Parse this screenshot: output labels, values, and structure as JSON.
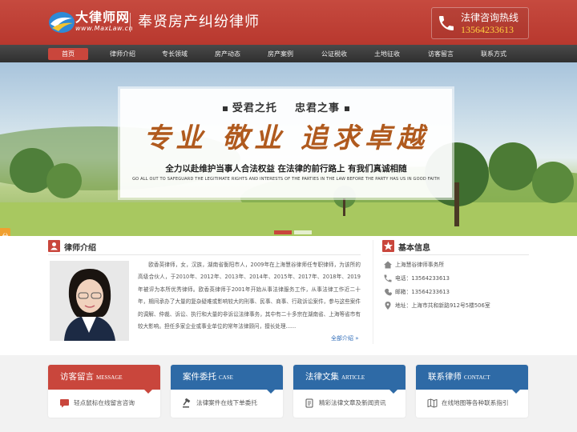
{
  "header": {
    "brand_cn": "大律师网",
    "brand_en": "www.MaxLaw.cn",
    "site_title": "奉贤房产纠纷律师",
    "hotline_label": "法律咨询热线",
    "hotline_number": "13564233613"
  },
  "nav": {
    "items": [
      {
        "label": "首页",
        "active": true
      },
      {
        "label": "律师介绍"
      },
      {
        "label": "专长领域"
      },
      {
        "label": "房产动态"
      },
      {
        "label": "房产案例"
      },
      {
        "label": "公证税收"
      },
      {
        "label": "土地征收"
      },
      {
        "label": "访客留言"
      },
      {
        "label": "联系方式"
      }
    ]
  },
  "banner": {
    "top_left": "受君之托",
    "top_right": "忠君之事",
    "slogan": "专业 敬业 追求卓越",
    "desc": "全力以赴维护当事人合法权益  在法律的前行路上  有我们真诚相随",
    "en": "GO ALL OUT TO SAFEGUARD THE LEGITIMATE RIGHTS AND INTERESTS OF THE PARTIES IN THE LAW BEFORE THE PARTY HAS US IN GOOD FAITH",
    "share": "分享"
  },
  "intro": {
    "title": "律师介绍",
    "text": "欧香英律师，女，汉族，湖南省衡阳市人，2009年在上海慧谷律师任专职律师，为该所的高级合伙人，于2010年、2012年、2013年、2014年、2015年、2017年、2018年、2019年被评为本所优秀律师。欧香英律师于2001年开始从事法律服务工作，从事法律工作近二十年，期间承办了大量的复杂疑难或影响较大的刑事、民事、商事、行政诉讼案件，参与这些案件的调解、仲裁、诉讼、执行和大量的非诉讼法律事务，其中有二十多宗在湖南省、上海等省市有较大影响。担任多家企业或事业单位的常年法律顾问，擅长处理......",
    "more": "全部介绍 »"
  },
  "info": {
    "title": "基本信息",
    "firm": "上海慧谷律师事务所",
    "phone": "电话：13564233613",
    "mobile": "邮箱：13564233613",
    "address": "地址：上海市共和新路912号5楼506室"
  },
  "cards": [
    {
      "title": "访客留言",
      "en": "MESSAGE",
      "desc": "轻点鼠标在线留言咨询",
      "color": "#c9463c"
    },
    {
      "title": "案件委托",
      "en": "CASE",
      "desc": "法律案件在线下单委托",
      "color": "#2e6aa6"
    },
    {
      "title": "法律文集",
      "en": "ARTICLE",
      "desc": "精彩法律文章及新闻资讯",
      "color": "#2e6aa6"
    },
    {
      "title": "联系律师",
      "en": "CONTACT",
      "desc": "在线地图等各种联系指引",
      "color": "#2e6aa6"
    }
  ],
  "icons": {
    "logo": "maxlaw-logo-icon",
    "hotline": "phone-icon",
    "intro": "user-icon",
    "info": "star-icon"
  }
}
